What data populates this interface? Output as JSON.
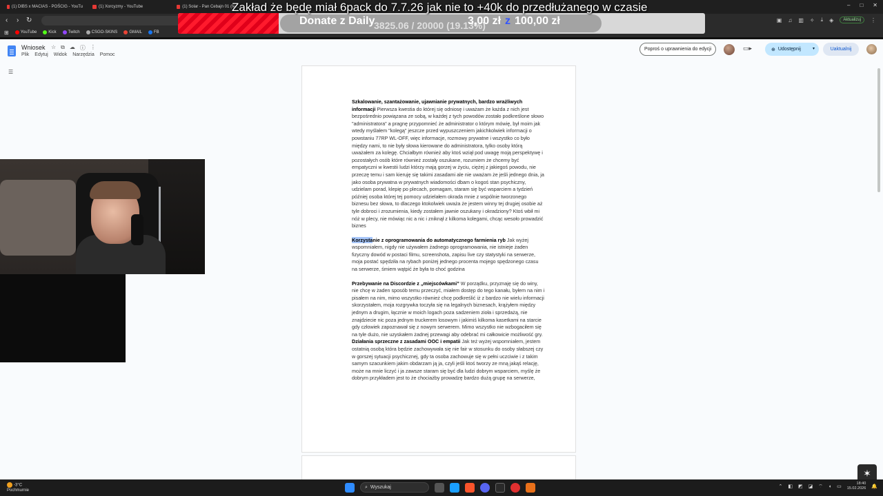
{
  "browser": {
    "tabs": [
      {
        "title": "(1) DIBS x MACIAS - POŚCIG - YouTu"
      },
      {
        "title": "(1) Xorcyzmy - YouTube"
      },
      {
        "title": "(1) Solar - Pan Cebajn 01 (fe..."
      }
    ],
    "window_controls": [
      "–",
      "□",
      "✕"
    ],
    "update_label": "Aktualizuj",
    "bookmarks": [
      {
        "label": "YouTube",
        "color": "#ff0000"
      },
      {
        "label": "Kick",
        "color": "#53fc18"
      },
      {
        "label": "Twitch",
        "color": "#9146ff"
      },
      {
        "label": "CSGO-SKINS",
        "color": "#aaaaaa"
      },
      {
        "label": "GMAIL",
        "color": "#ea4335"
      },
      {
        "label": "FB",
        "color": "#1877f2"
      }
    ]
  },
  "overlay": {
    "title": "Zakład że będę miał 6pack do 7.7.26 jak nie to +40k do przedłużanego w czasie",
    "donate_label": "Donate z Daily",
    "donate_progress": "3825.06 / 20000 (19.13%)",
    "donate_fraction": 0.1913,
    "donate_min": "3,00 zł",
    "donate_sep": "z",
    "donate_max": "100,00 zł"
  },
  "docs": {
    "title": "Wniosek",
    "menu": [
      "Plik",
      "Edytuj",
      "Widok",
      "Narzędzia",
      "Pomoc"
    ],
    "request_access": "Poproś o uprawnienia do edycji",
    "share": "Udostępnij",
    "update": "Uaktualnij"
  },
  "document": {
    "paragraphs": [
      {
        "heading": "Szkalowanie, szantażowanie, ujawnianie prywatnych, bardzo wrażliwych informacji",
        "body": "Pierwsza kwestia do której się odniosę i uważam że każda z nich jest bezpośrednio powiązana ze sobą, w każdej z tych powodów zostało podkreślone słowo \"administratora\" a pragnę przypomnieć że administrator o którym mówię, był moim jak wtedy myślałem \"kolegą\" jeszcze przed wypuszczeniem jakichkolwiek informacji o powstaniu 77RP WL-OFF, więc informacje, rozmowy prywatne i wszystko co było między nami, to nie były słowa kierowane do administratora, tylko osoby którą uważałem za kolegę. Chciałbym również aby ktoś wziął pod uwagę moją perspektywę i pozostałych osób które również zostały oszukane, rozumiem że chcemy być empatyczni w kwestii ludzi którzy mają gorzej w życiu, ciężej z jakiegoś powodu, nie przeczę temu i sam kieruję się takimi zasadami ale nie uważam że jeśli jednego dnia, ja jako osoba prywatna w prywatnych wiadomości dbam o kogoś stan psychiczny, udzielam porad, klepię po plecach, pomagam, staram się być wsparciem a tydzień później osoba której tej pomocy udzielałem okrada mnie z wspólnie tworzonego biznesu bez słowa, to dlaczego ktokolwiek uważa że jestem winny tej drugiej osobie aż tyle dobroci i zrozumienia, kiedy zostałem jawnie oszukany i okradziony? Ktoś wbił mi nóż w plecy, nie mówiąc nic a nic i zniknął z kilkoma kolegami, chcąc wesoło prowadzić biznes"
      },
      {
        "heading_highlight": "Korzysta",
        "heading": "nie z oprogramowania do automatycznego farmienia ryb",
        "body": "Jak wyżej wspomniałem, nigdy nie używałem żadnego oprogramowania, nie istnieje żaden fizyczny dowód w postaci filmu, screenshota, zapisu live czy statystyki na serwerze, moja postać spędziła na rybach poniżej jednego procenta mojego spędzonego czasu na serwerze, śmiem wątpić że była to choć godzina"
      },
      {
        "heading": "Przebywanie na Discordzie z „miejscówkami”",
        "body": "W porządku, przyznaję się do winy, nie chcę w żaden sposób temu przeczyć, miałem dostęp do tego kanału, byłem na nim i pisałem na nim, mimo wszystko również chcę podkreślić iż z bardzo nie wielu informacji skorzystałem, moja rozgrywka toczyła się na legalnych biznesach, krążyłem między jednym a drugim, łącznie w moich logach poza sadzeniem zioła i sprzedażą, nie znajdziecie nic poza jednym truckerem losowym i jakimiś kilkoma kasetkami na starcie gdy człowiek zapoznawał się z nowym serwerem. Mimo wszystko nie wzbogaciłem się na tyle dużo, nie uzyskałem żadnej przewagi aby odebrać mi całkowicie możliwość gry."
      },
      {
        "heading": "Działania sprzeczne z zasadami OOC i empatii",
        "body": "Jak też wyżej wspomniałem, jestem ostatnią osobą która będzie zachowywała się nie fair w stosunku do osoby słabszej czy w gorszej sytuacji psychicznej, gdy ta osoba zachowuje się w pełni uczciwie i z takim samym szacunkiem jakim obdarzam ją ja, czyli jeśli ktoś tworzy ze mną jakąś relację, może na mnie liczyć i ja zawsze staram się być dla ludzi dobrym wsparciem, myślę że dobrym przykładem jest to że chociażby prowadzę bardzo dużą grupę na serwerze,"
      }
    ]
  },
  "taskbar": {
    "weather_temp": "-3°C",
    "weather_desc": "Pochmurnie",
    "search_placeholder": "Wyszukaj",
    "time": "18:40",
    "date": "15.02.2026"
  }
}
